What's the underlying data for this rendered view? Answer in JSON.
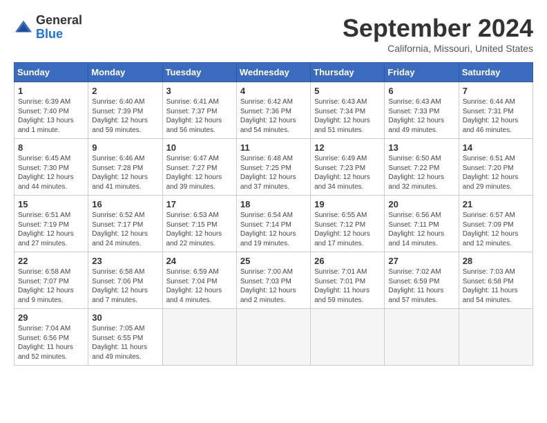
{
  "header": {
    "logo_line1": "General",
    "logo_line2": "Blue",
    "month": "September 2024",
    "location": "California, Missouri, United States"
  },
  "days_of_week": [
    "Sunday",
    "Monday",
    "Tuesday",
    "Wednesday",
    "Thursday",
    "Friday",
    "Saturday"
  ],
  "weeks": [
    [
      {
        "day": "1",
        "info": "Sunrise: 6:39 AM\nSunset: 7:40 PM\nDaylight: 13 hours\nand 1 minute."
      },
      {
        "day": "2",
        "info": "Sunrise: 6:40 AM\nSunset: 7:39 PM\nDaylight: 12 hours\nand 59 minutes."
      },
      {
        "day": "3",
        "info": "Sunrise: 6:41 AM\nSunset: 7:37 PM\nDaylight: 12 hours\nand 56 minutes."
      },
      {
        "day": "4",
        "info": "Sunrise: 6:42 AM\nSunset: 7:36 PM\nDaylight: 12 hours\nand 54 minutes."
      },
      {
        "day": "5",
        "info": "Sunrise: 6:43 AM\nSunset: 7:34 PM\nDaylight: 12 hours\nand 51 minutes."
      },
      {
        "day": "6",
        "info": "Sunrise: 6:43 AM\nSunset: 7:33 PM\nDaylight: 12 hours\nand 49 minutes."
      },
      {
        "day": "7",
        "info": "Sunrise: 6:44 AM\nSunset: 7:31 PM\nDaylight: 12 hours\nand 46 minutes."
      }
    ],
    [
      {
        "day": "8",
        "info": "Sunrise: 6:45 AM\nSunset: 7:30 PM\nDaylight: 12 hours\nand 44 minutes."
      },
      {
        "day": "9",
        "info": "Sunrise: 6:46 AM\nSunset: 7:28 PM\nDaylight: 12 hours\nand 41 minutes."
      },
      {
        "day": "10",
        "info": "Sunrise: 6:47 AM\nSunset: 7:27 PM\nDaylight: 12 hours\nand 39 minutes."
      },
      {
        "day": "11",
        "info": "Sunrise: 6:48 AM\nSunset: 7:25 PM\nDaylight: 12 hours\nand 37 minutes."
      },
      {
        "day": "12",
        "info": "Sunrise: 6:49 AM\nSunset: 7:23 PM\nDaylight: 12 hours\nand 34 minutes."
      },
      {
        "day": "13",
        "info": "Sunrise: 6:50 AM\nSunset: 7:22 PM\nDaylight: 12 hours\nand 32 minutes."
      },
      {
        "day": "14",
        "info": "Sunrise: 6:51 AM\nSunset: 7:20 PM\nDaylight: 12 hours\nand 29 minutes."
      }
    ],
    [
      {
        "day": "15",
        "info": "Sunrise: 6:51 AM\nSunset: 7:19 PM\nDaylight: 12 hours\nand 27 minutes."
      },
      {
        "day": "16",
        "info": "Sunrise: 6:52 AM\nSunset: 7:17 PM\nDaylight: 12 hours\nand 24 minutes."
      },
      {
        "day": "17",
        "info": "Sunrise: 6:53 AM\nSunset: 7:15 PM\nDaylight: 12 hours\nand 22 minutes."
      },
      {
        "day": "18",
        "info": "Sunrise: 6:54 AM\nSunset: 7:14 PM\nDaylight: 12 hours\nand 19 minutes."
      },
      {
        "day": "19",
        "info": "Sunrise: 6:55 AM\nSunset: 7:12 PM\nDaylight: 12 hours\nand 17 minutes."
      },
      {
        "day": "20",
        "info": "Sunrise: 6:56 AM\nSunset: 7:11 PM\nDaylight: 12 hours\nand 14 minutes."
      },
      {
        "day": "21",
        "info": "Sunrise: 6:57 AM\nSunset: 7:09 PM\nDaylight: 12 hours\nand 12 minutes."
      }
    ],
    [
      {
        "day": "22",
        "info": "Sunrise: 6:58 AM\nSunset: 7:07 PM\nDaylight: 12 hours\nand 9 minutes."
      },
      {
        "day": "23",
        "info": "Sunrise: 6:58 AM\nSunset: 7:06 PM\nDaylight: 12 hours\nand 7 minutes."
      },
      {
        "day": "24",
        "info": "Sunrise: 6:59 AM\nSunset: 7:04 PM\nDaylight: 12 hours\nand 4 minutes."
      },
      {
        "day": "25",
        "info": "Sunrise: 7:00 AM\nSunset: 7:03 PM\nDaylight: 12 hours\nand 2 minutes."
      },
      {
        "day": "26",
        "info": "Sunrise: 7:01 AM\nSunset: 7:01 PM\nDaylight: 11 hours\nand 59 minutes."
      },
      {
        "day": "27",
        "info": "Sunrise: 7:02 AM\nSunset: 6:59 PM\nDaylight: 11 hours\nand 57 minutes."
      },
      {
        "day": "28",
        "info": "Sunrise: 7:03 AM\nSunset: 6:58 PM\nDaylight: 11 hours\nand 54 minutes."
      }
    ],
    [
      {
        "day": "29",
        "info": "Sunrise: 7:04 AM\nSunset: 6:56 PM\nDaylight: 11 hours\nand 52 minutes."
      },
      {
        "day": "30",
        "info": "Sunrise: 7:05 AM\nSunset: 6:55 PM\nDaylight: 11 hours\nand 49 minutes."
      },
      {
        "day": "",
        "info": ""
      },
      {
        "day": "",
        "info": ""
      },
      {
        "day": "",
        "info": ""
      },
      {
        "day": "",
        "info": ""
      },
      {
        "day": "",
        "info": ""
      }
    ]
  ]
}
